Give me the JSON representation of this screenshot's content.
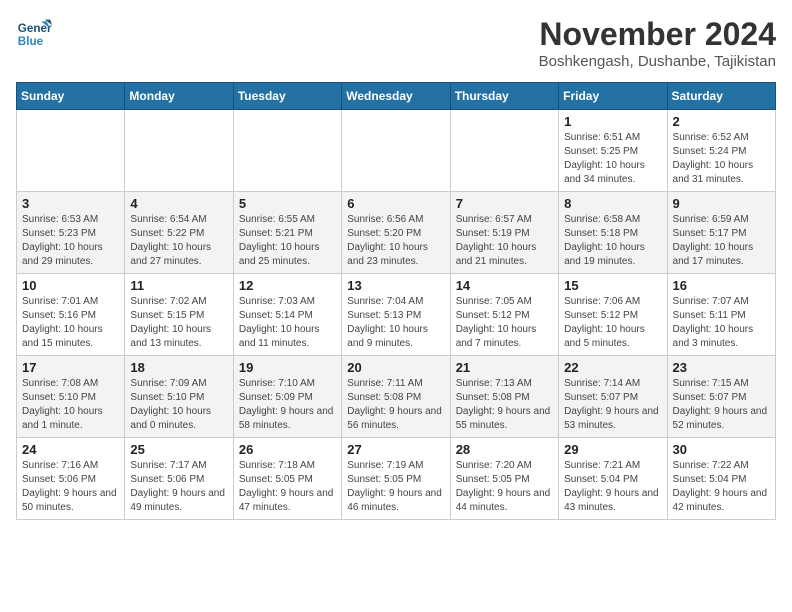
{
  "header": {
    "logo_line1": "General",
    "logo_line2": "Blue",
    "title": "November 2024",
    "subtitle": "Boshkengash, Dushanbe, Tajikistan"
  },
  "weekdays": [
    "Sunday",
    "Monday",
    "Tuesday",
    "Wednesday",
    "Thursday",
    "Friday",
    "Saturday"
  ],
  "weeks": [
    [
      {
        "day": "",
        "info": ""
      },
      {
        "day": "",
        "info": ""
      },
      {
        "day": "",
        "info": ""
      },
      {
        "day": "",
        "info": ""
      },
      {
        "day": "",
        "info": ""
      },
      {
        "day": "1",
        "info": "Sunrise: 6:51 AM\nSunset: 5:25 PM\nDaylight: 10 hours and 34 minutes."
      },
      {
        "day": "2",
        "info": "Sunrise: 6:52 AM\nSunset: 5:24 PM\nDaylight: 10 hours and 31 minutes."
      }
    ],
    [
      {
        "day": "3",
        "info": "Sunrise: 6:53 AM\nSunset: 5:23 PM\nDaylight: 10 hours and 29 minutes."
      },
      {
        "day": "4",
        "info": "Sunrise: 6:54 AM\nSunset: 5:22 PM\nDaylight: 10 hours and 27 minutes."
      },
      {
        "day": "5",
        "info": "Sunrise: 6:55 AM\nSunset: 5:21 PM\nDaylight: 10 hours and 25 minutes."
      },
      {
        "day": "6",
        "info": "Sunrise: 6:56 AM\nSunset: 5:20 PM\nDaylight: 10 hours and 23 minutes."
      },
      {
        "day": "7",
        "info": "Sunrise: 6:57 AM\nSunset: 5:19 PM\nDaylight: 10 hours and 21 minutes."
      },
      {
        "day": "8",
        "info": "Sunrise: 6:58 AM\nSunset: 5:18 PM\nDaylight: 10 hours and 19 minutes."
      },
      {
        "day": "9",
        "info": "Sunrise: 6:59 AM\nSunset: 5:17 PM\nDaylight: 10 hours and 17 minutes."
      }
    ],
    [
      {
        "day": "10",
        "info": "Sunrise: 7:01 AM\nSunset: 5:16 PM\nDaylight: 10 hours and 15 minutes."
      },
      {
        "day": "11",
        "info": "Sunrise: 7:02 AM\nSunset: 5:15 PM\nDaylight: 10 hours and 13 minutes."
      },
      {
        "day": "12",
        "info": "Sunrise: 7:03 AM\nSunset: 5:14 PM\nDaylight: 10 hours and 11 minutes."
      },
      {
        "day": "13",
        "info": "Sunrise: 7:04 AM\nSunset: 5:13 PM\nDaylight: 10 hours and 9 minutes."
      },
      {
        "day": "14",
        "info": "Sunrise: 7:05 AM\nSunset: 5:12 PM\nDaylight: 10 hours and 7 minutes."
      },
      {
        "day": "15",
        "info": "Sunrise: 7:06 AM\nSunset: 5:12 PM\nDaylight: 10 hours and 5 minutes."
      },
      {
        "day": "16",
        "info": "Sunrise: 7:07 AM\nSunset: 5:11 PM\nDaylight: 10 hours and 3 minutes."
      }
    ],
    [
      {
        "day": "17",
        "info": "Sunrise: 7:08 AM\nSunset: 5:10 PM\nDaylight: 10 hours and 1 minute."
      },
      {
        "day": "18",
        "info": "Sunrise: 7:09 AM\nSunset: 5:10 PM\nDaylight: 10 hours and 0 minutes."
      },
      {
        "day": "19",
        "info": "Sunrise: 7:10 AM\nSunset: 5:09 PM\nDaylight: 9 hours and 58 minutes."
      },
      {
        "day": "20",
        "info": "Sunrise: 7:11 AM\nSunset: 5:08 PM\nDaylight: 9 hours and 56 minutes."
      },
      {
        "day": "21",
        "info": "Sunrise: 7:13 AM\nSunset: 5:08 PM\nDaylight: 9 hours and 55 minutes."
      },
      {
        "day": "22",
        "info": "Sunrise: 7:14 AM\nSunset: 5:07 PM\nDaylight: 9 hours and 53 minutes."
      },
      {
        "day": "23",
        "info": "Sunrise: 7:15 AM\nSunset: 5:07 PM\nDaylight: 9 hours and 52 minutes."
      }
    ],
    [
      {
        "day": "24",
        "info": "Sunrise: 7:16 AM\nSunset: 5:06 PM\nDaylight: 9 hours and 50 minutes."
      },
      {
        "day": "25",
        "info": "Sunrise: 7:17 AM\nSunset: 5:06 PM\nDaylight: 9 hours and 49 minutes."
      },
      {
        "day": "26",
        "info": "Sunrise: 7:18 AM\nSunset: 5:05 PM\nDaylight: 9 hours and 47 minutes."
      },
      {
        "day": "27",
        "info": "Sunrise: 7:19 AM\nSunset: 5:05 PM\nDaylight: 9 hours and 46 minutes."
      },
      {
        "day": "28",
        "info": "Sunrise: 7:20 AM\nSunset: 5:05 PM\nDaylight: 9 hours and 44 minutes."
      },
      {
        "day": "29",
        "info": "Sunrise: 7:21 AM\nSunset: 5:04 PM\nDaylight: 9 hours and 43 minutes."
      },
      {
        "day": "30",
        "info": "Sunrise: 7:22 AM\nSunset: 5:04 PM\nDaylight: 9 hours and 42 minutes."
      }
    ]
  ]
}
